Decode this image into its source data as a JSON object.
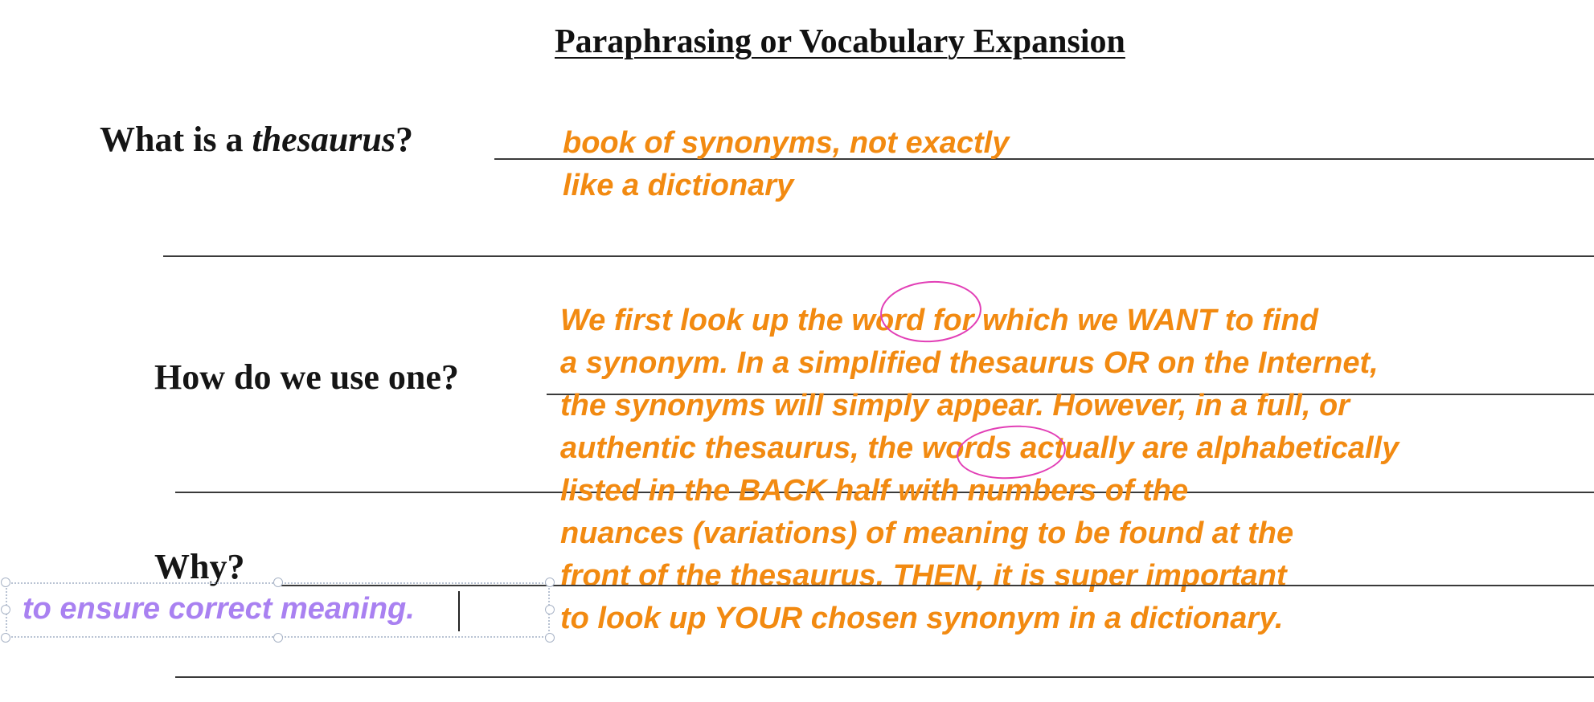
{
  "worksheet": {
    "title": "Paraphrasing or Vocabulary Expansion",
    "question1": {
      "prefix": "What is a ",
      "italic_word": "thesaurus",
      "suffix": "?"
    },
    "question2": "How do we use one?",
    "question3": "Why?"
  },
  "annotations": {
    "answer1_lines": [
      "book of synonyms, not exactly",
      "like a dictionary"
    ],
    "answer2_lines": [
      "We first look up the word for which we WANT to find",
      "a synonym.  In a simplified thesaurus OR on the Internet,",
      "the synonyms will simply appear.  However, in a full, or",
      "authentic thesaurus, the words actually are alphabetically",
      " listed in the BACK half with numbers of the",
      " nuances (variations) of meaning to be found at the",
      " front of the thesaurus.  THEN, it is super important",
      " to look up YOUR chosen synonym in a dictionary."
    ],
    "answer3_editing": "to ensure correct meaning.",
    "colors": {
      "answer_orange": "#f28a11",
      "edit_purple": "#a981f1",
      "circle_pink": "#e23fb6"
    }
  }
}
